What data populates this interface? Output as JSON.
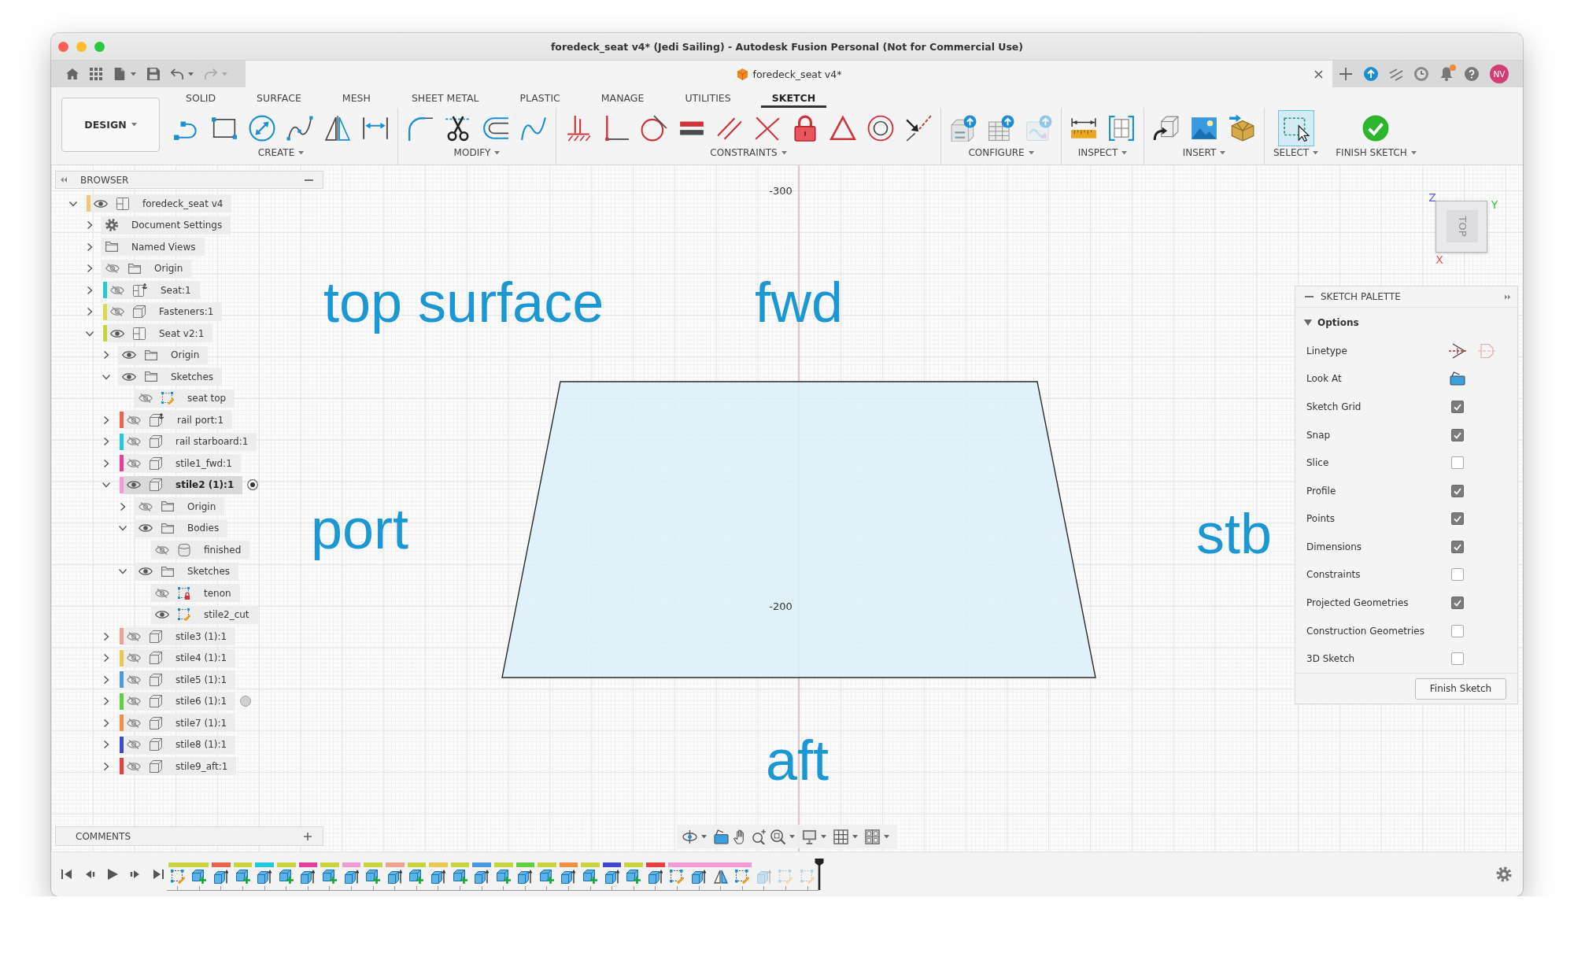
{
  "window": {
    "title": "foredeck_seat v4* (Jedi Sailing) - Autodesk Fusion Personal (Not for Commercial Use)"
  },
  "quick_access": {
    "undo": {
      "disabled": false
    },
    "redo": {
      "disabled": true
    }
  },
  "document_tab": {
    "title": "foredeck_seat v4*"
  },
  "notifications": {
    "unread": true
  },
  "user": {
    "initials": "NV"
  },
  "ribbon": {
    "workspace": "DESIGN",
    "tabs": [
      {
        "label": "SOLID",
        "selected": false
      },
      {
        "label": "SURFACE",
        "selected": false
      },
      {
        "label": "MESH",
        "selected": false
      },
      {
        "label": "SHEET METAL",
        "selected": false
      },
      {
        "label": "PLASTIC",
        "selected": false
      },
      {
        "label": "MANAGE",
        "selected": false
      },
      {
        "label": "UTILITIES",
        "selected": false
      },
      {
        "label": "SKETCH",
        "selected": true
      }
    ],
    "groups": [
      {
        "label": "CREATE",
        "tools": [
          {
            "selected": false,
            "disabled": false
          },
          {
            "selected": false,
            "disabled": false
          },
          {
            "selected": false,
            "disabled": false
          },
          {
            "selected": false,
            "disabled": false
          },
          {
            "selected": false,
            "disabled": false
          },
          {
            "selected": false,
            "disabled": false
          }
        ]
      },
      {
        "label": "MODIFY",
        "tools": [
          {
            "selected": false,
            "disabled": false
          },
          {
            "selected": false,
            "disabled": false
          },
          {
            "selected": false,
            "disabled": false
          },
          {
            "selected": false,
            "disabled": false
          }
        ]
      },
      {
        "label": "CONSTRAINTS",
        "tools": [
          {
            "selected": false,
            "disabled": false
          },
          {
            "selected": false,
            "disabled": false
          },
          {
            "selected": false,
            "disabled": false
          },
          {
            "selected": false,
            "disabled": false
          },
          {
            "selected": false,
            "disabled": false
          },
          {
            "selected": false,
            "disabled": false
          },
          {
            "selected": false,
            "disabled": false
          },
          {
            "selected": false,
            "disabled": false
          },
          {
            "selected": false,
            "disabled": false
          },
          {
            "selected": false,
            "disabled": false
          }
        ]
      },
      {
        "label": "CONFIGURE",
        "tools": [
          {
            "selected": false,
            "disabled": false
          },
          {
            "selected": false,
            "disabled": false
          },
          {
            "selected": false,
            "disabled": true
          }
        ]
      },
      {
        "label": "INSPECT",
        "tools": [
          {
            "selected": false,
            "disabled": false
          },
          {
            "selected": false,
            "disabled": false
          }
        ]
      },
      {
        "label": "INSERT",
        "tools": [
          {
            "selected": false,
            "disabled": false
          },
          {
            "selected": false,
            "disabled": false
          },
          {
            "selected": false,
            "disabled": false
          }
        ]
      },
      {
        "label": "SELECT",
        "tools": [
          {
            "selected": true,
            "disabled": false
          }
        ]
      },
      {
        "label": "FINISH SKETCH",
        "tools": [
          {
            "selected": false,
            "disabled": false
          }
        ]
      }
    ]
  },
  "browser": {
    "title": "BROWSER",
    "items": [
      {
        "label": "foredeck_seat v4",
        "kind": "assembly",
        "color": "#f2c778",
        "visible": true,
        "expanded": true,
        "children": [
          {
            "label": "Document Settings",
            "kind": "settings",
            "expanded": false
          },
          {
            "label": "Named Views",
            "kind": "folder",
            "expanded": false
          },
          {
            "label": "Origin",
            "kind": "folder",
            "visible": false,
            "expanded": false
          },
          {
            "label": "Seat:1",
            "kind": "pinnedassembly",
            "color": "#22cbd0",
            "visible": false,
            "expanded": false
          },
          {
            "label": "Fasteners:1",
            "kind": "part",
            "color": "#d6da4c",
            "visible": false,
            "expanded": false
          },
          {
            "label": "Seat v2:1",
            "kind": "assembly",
            "color": "#c9d43c",
            "visible": true,
            "expanded": true,
            "children": [
              {
                "label": "Origin",
                "kind": "folder",
                "visible": true,
                "expanded": false
              },
              {
                "label": "Sketches",
                "kind": "folder",
                "visible": true,
                "expanded": true,
                "children": [
                  {
                    "label": "seat top",
                    "kind": "sketch",
                    "visible": false
                  }
                ]
              },
              {
                "label": "rail port:1",
                "kind": "pinnedpart",
                "color": "#e8654a",
                "visible": false,
                "expanded": false
              },
              {
                "label": "rail starboard:1",
                "kind": "part",
                "color": "#22c8e0",
                "visible": false,
                "expanded": false
              },
              {
                "label": "stile1_fwd:1",
                "kind": "part",
                "color": "#e83c9a",
                "visible": false,
                "expanded": false
              },
              {
                "label": "stile2 (1):1",
                "kind": "part",
                "color": "#f29ad6",
                "visible": true,
                "expanded": true,
                "active": true,
                "children": [
                  {
                    "label": "Origin",
                    "kind": "folder",
                    "visible": false,
                    "expanded": false
                  },
                  {
                    "label": "Bodies",
                    "kind": "folder",
                    "visible": true,
                    "expanded": true,
                    "children": [
                      {
                        "label": "finished",
                        "kind": "body",
                        "visible": false
                      }
                    ]
                  },
                  {
                    "label": "Sketches",
                    "kind": "folder",
                    "visible": true,
                    "expanded": true,
                    "children": [
                      {
                        "label": "tenon",
                        "kind": "lockedsketch",
                        "visible": false
                      },
                      {
                        "label": "stile2_cut",
                        "kind": "sketch",
                        "visible": true
                      }
                    ]
                  }
                ]
              },
              {
                "label": "stile3 (1):1",
                "kind": "part",
                "color": "#f0a090",
                "visible": false,
                "expanded": false
              },
              {
                "label": "stile4 (1):1",
                "kind": "part",
                "color": "#e8c850",
                "visible": false,
                "expanded": false
              },
              {
                "label": "stile5 (1):1",
                "kind": "part",
                "color": "#4a98e0",
                "visible": false,
                "expanded": false
              },
              {
                "label": "stile6 (1):1",
                "kind": "part",
                "color": "#60d040",
                "visible": false,
                "expanded": false,
                "active": false
              },
              {
                "label": "stile7 (1):1",
                "kind": "part",
                "color": "#f09040",
                "visible": false,
                "expanded": false
              },
              {
                "label": "stile8 (1):1",
                "kind": "part",
                "color": "#4048d0",
                "visible": false,
                "expanded": false
              },
              {
                "label": "stile9_aft:1",
                "kind": "part",
                "color": "#e84040",
                "visible": false,
                "expanded": false
              }
            ]
          }
        ]
      }
    ]
  },
  "comments": {
    "title": "COMMENTS"
  },
  "canvas": {
    "labels": [
      "top surface",
      "fwd",
      "port",
      "stb",
      "aft"
    ],
    "grid_labels": [
      "-300",
      "-200"
    ]
  },
  "view_cube": {
    "face": "TOP",
    "axes": [
      "Z",
      "Y",
      "X"
    ]
  },
  "sketch_palette": {
    "title": "SKETCH PALETTE",
    "section": {
      "label": "Options",
      "expanded": true
    },
    "options": [
      {
        "label": "Linetype",
        "kind": "linetype"
      },
      {
        "label": "Look At",
        "kind": "lookat"
      },
      {
        "label": "Sketch Grid",
        "kind": "checkbox",
        "checked": true
      },
      {
        "label": "Snap",
        "kind": "checkbox",
        "checked": true
      },
      {
        "label": "Slice",
        "kind": "checkbox",
        "checked": false
      },
      {
        "label": "Profile",
        "kind": "checkbox",
        "checked": true
      },
      {
        "label": "Points",
        "kind": "checkbox",
        "checked": true
      },
      {
        "label": "Dimensions",
        "kind": "checkbox",
        "checked": true
      },
      {
        "label": "Constraints",
        "kind": "checkbox",
        "checked": false
      },
      {
        "label": "Projected Geometries",
        "kind": "checkbox",
        "checked": true
      },
      {
        "label": "Construction Geometries",
        "kind": "checkbox",
        "checked": false
      },
      {
        "label": "3D Sketch",
        "kind": "checkbox",
        "checked": false
      }
    ],
    "button": "Finish Sketch"
  },
  "timeline": {
    "items": [
      {
        "kind": "sketch",
        "color": "#c9d43c",
        "disabled": false
      },
      {
        "kind": "newcomponent",
        "color": "#c9d43c",
        "disabled": false
      },
      {
        "kind": "extrude",
        "color": "#e8654a",
        "disabled": false
      },
      {
        "kind": "newcomponent",
        "color": "#c9d43c",
        "disabled": false
      },
      {
        "kind": "extrude",
        "color": "#22c8e0",
        "disabled": false
      },
      {
        "kind": "newcomponent",
        "color": "#c9d43c",
        "disabled": false
      },
      {
        "kind": "extrude",
        "color": "#e83c9a",
        "disabled": false
      },
      {
        "kind": "newcomponent",
        "color": "#c9d43c",
        "disabled": false
      },
      {
        "kind": "extrude",
        "color": "#f29ad6",
        "disabled": false
      },
      {
        "kind": "newcomponent",
        "color": "#c9d43c",
        "disabled": false
      },
      {
        "kind": "extrude",
        "color": "#f0a090",
        "disabled": false
      },
      {
        "kind": "newcomponent",
        "color": "#c9d43c",
        "disabled": false
      },
      {
        "kind": "extrude",
        "color": "#e8c850",
        "disabled": false
      },
      {
        "kind": "newcomponent",
        "color": "#c9d43c",
        "disabled": false
      },
      {
        "kind": "extrude",
        "color": "#4a98e0",
        "disabled": false
      },
      {
        "kind": "newcomponent",
        "color": "#c9d43c",
        "disabled": false
      },
      {
        "kind": "extrude",
        "color": "#60d040",
        "disabled": false
      },
      {
        "kind": "newcomponent",
        "color": "#c9d43c",
        "disabled": false
      },
      {
        "kind": "extrude",
        "color": "#f09040",
        "disabled": false
      },
      {
        "kind": "newcomponent",
        "color": "#c9d43c",
        "disabled": false
      },
      {
        "kind": "extrude",
        "color": "#4048d0",
        "disabled": false
      },
      {
        "kind": "newcomponent",
        "color": "#c9d43c",
        "disabled": false
      },
      {
        "kind": "extrude",
        "color": "#e84040",
        "disabled": false
      },
      {
        "kind": "sketch",
        "color": "#f29ad6",
        "disabled": false
      },
      {
        "kind": "extrude",
        "color": "#f29ad6",
        "disabled": false
      },
      {
        "kind": "mirror",
        "color": "#f29ad6",
        "disabled": false
      },
      {
        "kind": "sketch",
        "color": "#f29ad6",
        "disabled": false
      },
      {
        "kind": "extrude",
        "disabled": true
      },
      {
        "kind": "sketch",
        "disabled": true
      },
      {
        "kind": "sketch",
        "disabled": true
      }
    ]
  }
}
